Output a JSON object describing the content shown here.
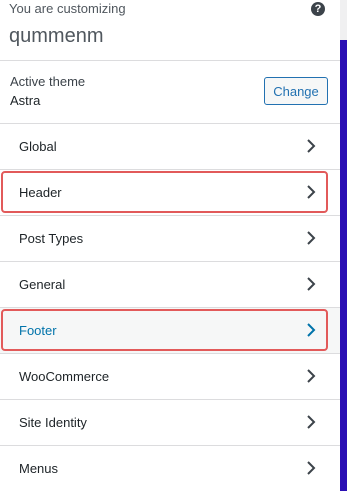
{
  "header": {
    "subtitle": "You are customizing",
    "site_name": "qummenm",
    "help_icon_symbol": "?"
  },
  "theme": {
    "label": "Active theme",
    "name": "Astra",
    "change_label": "Change"
  },
  "menu": {
    "items": [
      {
        "label": "Global"
      },
      {
        "label": "Header"
      },
      {
        "label": "Post Types"
      },
      {
        "label": "General"
      },
      {
        "label": "Footer"
      },
      {
        "label": "WooCommerce"
      },
      {
        "label": "Site Identity"
      },
      {
        "label": "Menus"
      }
    ]
  },
  "colors": {
    "accent": "#2271b1",
    "active_text": "#0073aa",
    "highlight_border": "#e25a5a",
    "right_edge": "#2a0fb4"
  }
}
